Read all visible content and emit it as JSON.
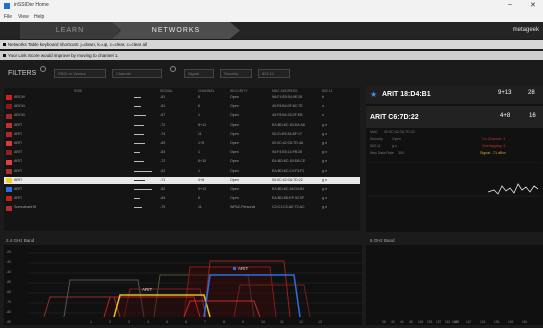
{
  "window": {
    "title": "inSSIDer Home",
    "minimize": "–",
    "close": "✕"
  },
  "menu": [
    "File",
    "View",
    "Help"
  ],
  "nav": {
    "tab_learn": "LEARN",
    "tab_networks": "NETWORKS",
    "brand": "metageek"
  },
  "notices": [
    "Networks Table keyboard shortcuts: j=down, k=up, c=clear, c=clear all",
    "Your Link Score would improve by moving to channel 1."
  ],
  "filters": {
    "label": "FILTERS",
    "ssid_placeholder": "SSID or Vendor",
    "channel_placeholder": "Channel",
    "signal_placeholder": "Signal",
    "security_label": "Security",
    "mode_label": "802.11"
  },
  "table": {
    "columns": [
      "SSID",
      "SIGNAL",
      "CHANNEL",
      "SECURITY",
      "MAC ADDRESS",
      "802.11"
    ],
    "rows": [
      {
        "ssid": "ARCM",
        "signal": "-81",
        "channel": "6",
        "security": "Open",
        "mac": "9A:F4:E5:54:9E:28",
        "mode": "b",
        "color": "#d02020"
      },
      {
        "ssid": "ARCM",
        "signal": "-81",
        "channel": "6",
        "security": "Open",
        "mac": "40:F8:B4:0F:8C:7E",
        "mode": "n",
        "color": "#8a1a1a"
      },
      {
        "ssid": "ARCM",
        "signal": "-67",
        "channel": "1",
        "security": "Open",
        "mac": "40:F8:B4:33:2F:EB",
        "mode": "n",
        "color": "#a02a2a"
      },
      {
        "ssid": "ARIT",
        "signal": "-72",
        "channel": "8+12",
        "security": "Open",
        "mac": "EA:BD:8C:1B:D4:A8",
        "mode": "g n",
        "color": "#c03030"
      },
      {
        "ssid": "ARIT",
        "signal": "-74",
        "channel": "11",
        "security": "Open",
        "mac": "00:21:E9:3A:8F:17",
        "mode": "g n",
        "color": "#b02828"
      },
      {
        "ssid": "ARIT",
        "signal": "-69",
        "channel": "1+5",
        "security": "Open",
        "mac": "00:0C:42:C6:7D:4A",
        "mode": "g n",
        "color": "#d83a3a"
      },
      {
        "ssid": "ARIT",
        "signal": "-83",
        "channel": "1",
        "security": "Open",
        "mac": "94:F4:E5:14:FB:28",
        "mode": "g n",
        "color": "#902020"
      },
      {
        "ssid": "ARIT",
        "signal": "-72",
        "channel": "6+10",
        "security": "Open",
        "mac": "EA:BD:8C:1B:D8:CE",
        "mode": "g n",
        "color": "#e04040"
      },
      {
        "ssid": "ARIT",
        "signal": "-52",
        "channel": "1",
        "security": "Open",
        "mac": "EA:BD:8C:C4:F3:F2",
        "mode": "g n",
        "color": "#a83030"
      },
      {
        "ssid": "ARIT",
        "signal": "-71",
        "channel": "4+8",
        "security": "Open",
        "mac": "00:0C:42:C6:7D:22",
        "mode": "g n",
        "color": "#f0d020"
      },
      {
        "ssid": "ARIT",
        "signal": "-52",
        "channel": "9+13",
        "security": "Open",
        "mac": "EA:BD:8C:18:D4:B1",
        "mode": "g n",
        "color": "#2a6fe0"
      },
      {
        "ssid": "ARIT",
        "signal": "-84",
        "channel": "6",
        "security": "Open",
        "mac": "EA:BD:8D:EF:92:0F",
        "mode": "g n",
        "color": "#c02020"
      },
      {
        "ssid": "SumnahanHill",
        "signal": "-79",
        "channel": "11",
        "security": "WPA2-Personal",
        "mac": "C0:C1:C0:AE:72:AC",
        "mode": "g n",
        "color": "#b03030"
      }
    ]
  },
  "detail_top": {
    "name": "ARIT 18:D4:B1",
    "channel": "9+13",
    "signal": "28"
  },
  "detail_main": {
    "name": "ARIT C6:7D:22",
    "channel": "4+8",
    "signal": "16",
    "mac_label": "MAC",
    "mac_value": "00:0C:42:C6:7D:22",
    "security_label": "Security",
    "security_value": "Open",
    "mode_label": "802.11",
    "mode_value": "g n",
    "rate_label": "Max Data Rate",
    "rate_value": "300",
    "co_channel": "Co-Channel: 3",
    "overlapping": "Overlapping: 9",
    "signal_text": "Signal: -71 dBm"
  },
  "band24": {
    "label": "2.4 GHz Band",
    "y_ticks": [
      "-20",
      "-30",
      "-40",
      "-50",
      "-60",
      "-70",
      "-80",
      "-90"
    ],
    "x_ticks": [
      "1",
      "2",
      "3",
      "4",
      "5",
      "6",
      "7",
      "8",
      "9",
      "10",
      "11",
      "12",
      "13"
    ],
    "labels": [
      "ARIT",
      "ARIT"
    ]
  },
  "band5": {
    "label": "5 GHz Band",
    "x_ticks": [
      "36",
      "40",
      "44",
      "48",
      "149",
      "153",
      "157",
      "161",
      "165"
    ],
    "upper_ticks": [
      "100",
      "112",
      "124",
      "136",
      "149",
      "161"
    ]
  }
}
